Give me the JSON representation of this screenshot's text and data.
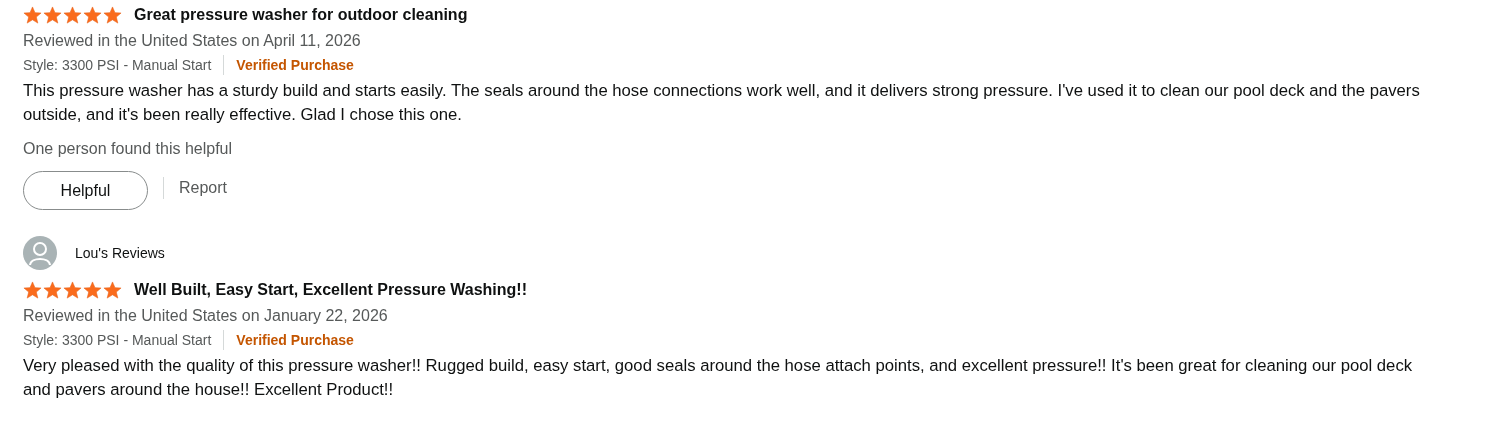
{
  "reviews": [
    {
      "stars": 5,
      "title": "Great pressure washer for outdoor cleaning",
      "reviewed": "Reviewed in the United States on April 11, 2026",
      "style": "Style: 3300 PSI - Manual Start",
      "verified": "Verified Purchase",
      "body": "This pressure washer has a sturdy build and starts easily. The seals around the hose connections work well, and it delivers strong pressure. I've used it to clean our pool deck and the pavers outside, and it's been really effective. Glad I chose this one.",
      "helpful_count": "One person found this helpful",
      "helpful_button": "Helpful",
      "report": "Report"
    },
    {
      "reviewer": "Lou's Reviews",
      "stars": 5,
      "title": "Well Built, Easy Start, Excellent Pressure Washing!!",
      "reviewed": "Reviewed in the United States on January 22, 2026",
      "style": "Style: 3300 PSI - Manual Start",
      "verified": "Verified Purchase",
      "body": "Very pleased with the quality of this pressure washer!! Rugged build, easy start, good seals around the hose attach points, and excellent pressure!! It's been great for cleaning our pool deck and pavers around the house!! Excellent Product!!"
    }
  ]
}
